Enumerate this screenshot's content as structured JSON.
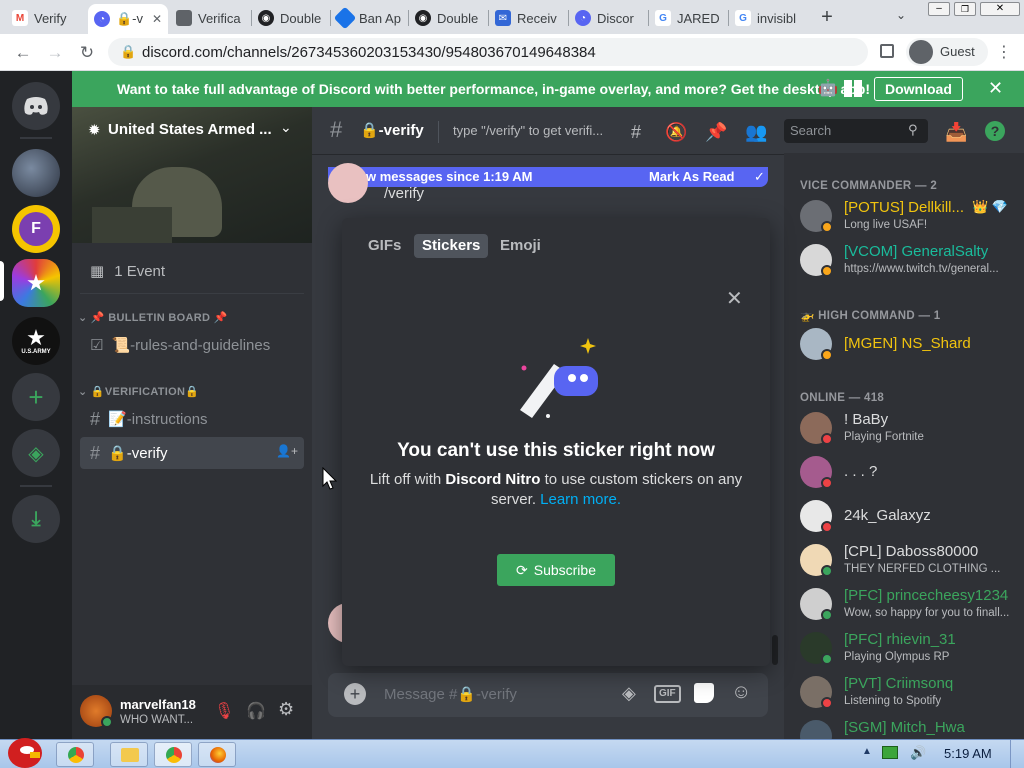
{
  "browser": {
    "tabs": [
      {
        "label": "Verify",
        "icon": "gmail-icon",
        "color": "#ea4335"
      },
      {
        "label": "🔒-v",
        "icon": "discord-icon",
        "color": "#5865f2",
        "active": true
      },
      {
        "label": "Verifica",
        "icon": "verification-icon",
        "color": "#5f6368"
      },
      {
        "label": "Double",
        "icon": "double-icon",
        "color": "#202124"
      },
      {
        "label": "Ban Ap",
        "icon": "ban-appeal-icon",
        "color": "#1a73e8"
      },
      {
        "label": "Double",
        "icon": "double-icon",
        "color": "#202124"
      },
      {
        "label": "Receiv",
        "icon": "receive-icon",
        "color": "#3367d6"
      },
      {
        "label": "Discor",
        "icon": "discord-icon",
        "color": "#5865f2"
      },
      {
        "label": "JARED",
        "icon": "google-icon",
        "color": "#4285f4"
      },
      {
        "label": "invisibl",
        "icon": "google-icon",
        "color": "#4285f4"
      }
    ],
    "url": "discord.com/channels/267345360203153430/954803670149648384",
    "profile_label": "Guest"
  },
  "banner": {
    "text": "Want to take full advantage of Discord with better performance, in-game overlay, and more? Get the desktop app!",
    "download_label": "Download"
  },
  "server": {
    "name": "United States Armed ...",
    "events_label": "1 Event",
    "categories": [
      {
        "name": "📌 BULLETIN BOARD 📌",
        "channels": [
          {
            "name": "📜-rules-and-guidelines",
            "icon": "rules-channel-icon"
          }
        ]
      },
      {
        "name": "🔒VERIFICATION🔒",
        "channels": [
          {
            "name": "📝-instructions",
            "icon": "hash-icon"
          },
          {
            "name": "🔒-verify",
            "icon": "hash-icon",
            "active": true
          }
        ]
      }
    ]
  },
  "user": {
    "name": "marvelfan18",
    "status": "WHO WANT..."
  },
  "channel": {
    "name": "🔒-verify",
    "topic": "type \"/verify\" to get verifi...",
    "search_placeholder": "Search",
    "new_messages": "2 new messages since 1:19 AM",
    "mark_read": "Mark As Read",
    "message_text": "/verify",
    "input_placeholder": "Message #🔒-verify"
  },
  "picker": {
    "tabs": [
      "GIFs",
      "Stickers",
      "Emoji"
    ],
    "active_tab": "Stickers",
    "title": "You can't use this sticker right now",
    "body_prefix": "Lift off with ",
    "body_bold": "Discord Nitro",
    "body_suffix": " to use custom stickers on any server.",
    "learn_more": "Learn more.",
    "subscribe_label": "Subscribe"
  },
  "members": {
    "groups": [
      {
        "title": "VICE COMMANDER — 2",
        "members": [
          {
            "name": "[POTUS] Dellkill...",
            "sub": "Long live USAF!",
            "color": "#f1c40f",
            "status": "#faa61a",
            "badges": "👑 💎"
          },
          {
            "name": "[VCOM] GeneralSalty",
            "sub": "https://www.twitch.tv/general...",
            "color": "#1abc9c",
            "status": "#faa61a"
          }
        ]
      },
      {
        "title": "🚁 HIGH COMMAND — 1",
        "members": [
          {
            "name": "[MGEN] NS_Shard",
            "sub": "",
            "color": "#f1c40f",
            "status": "#faa61a"
          }
        ]
      },
      {
        "title": "ONLINE — 418",
        "members": [
          {
            "name": "! BaBy",
            "sub": "Playing Fortnite",
            "color": "#dcddde",
            "status": "#ed4245"
          },
          {
            "name": ". . . ?",
            "sub": "",
            "color": "#dcddde",
            "status": "#ed4245"
          },
          {
            "name": "24k_Galaxyz",
            "sub": "",
            "color": "#dcddde",
            "status": "#ed4245"
          },
          {
            "name": "[CPL] Daboss80000",
            "sub": "THEY NERFED CLOTHING ...",
            "color": "#dcddde",
            "status": "#3ba55d"
          },
          {
            "name": "[PFC] princecheesy1234",
            "sub": "Wow, so happy for you to finall...",
            "color": "#3ba55d",
            "status": "#3ba55d"
          },
          {
            "name": "[PFC] rhievin_31",
            "sub": "Playing Olympus RP",
            "color": "#3ba55d",
            "status": "#3ba55d"
          },
          {
            "name": "[PVT] Criimsonq",
            "sub": "Listening to Spotify",
            "color": "#3ba55d",
            "status": "#ed4245"
          },
          {
            "name": "[SGM] Mitch_Hwa",
            "sub": "",
            "color": "#3ba55d",
            "status": "#ed4245"
          }
        ]
      }
    ]
  },
  "taskbar": {
    "clock": "5:19 AM"
  },
  "colors": {
    "blurple": "#5865f2",
    "green": "#3ba55d",
    "link": "#00aff4"
  }
}
